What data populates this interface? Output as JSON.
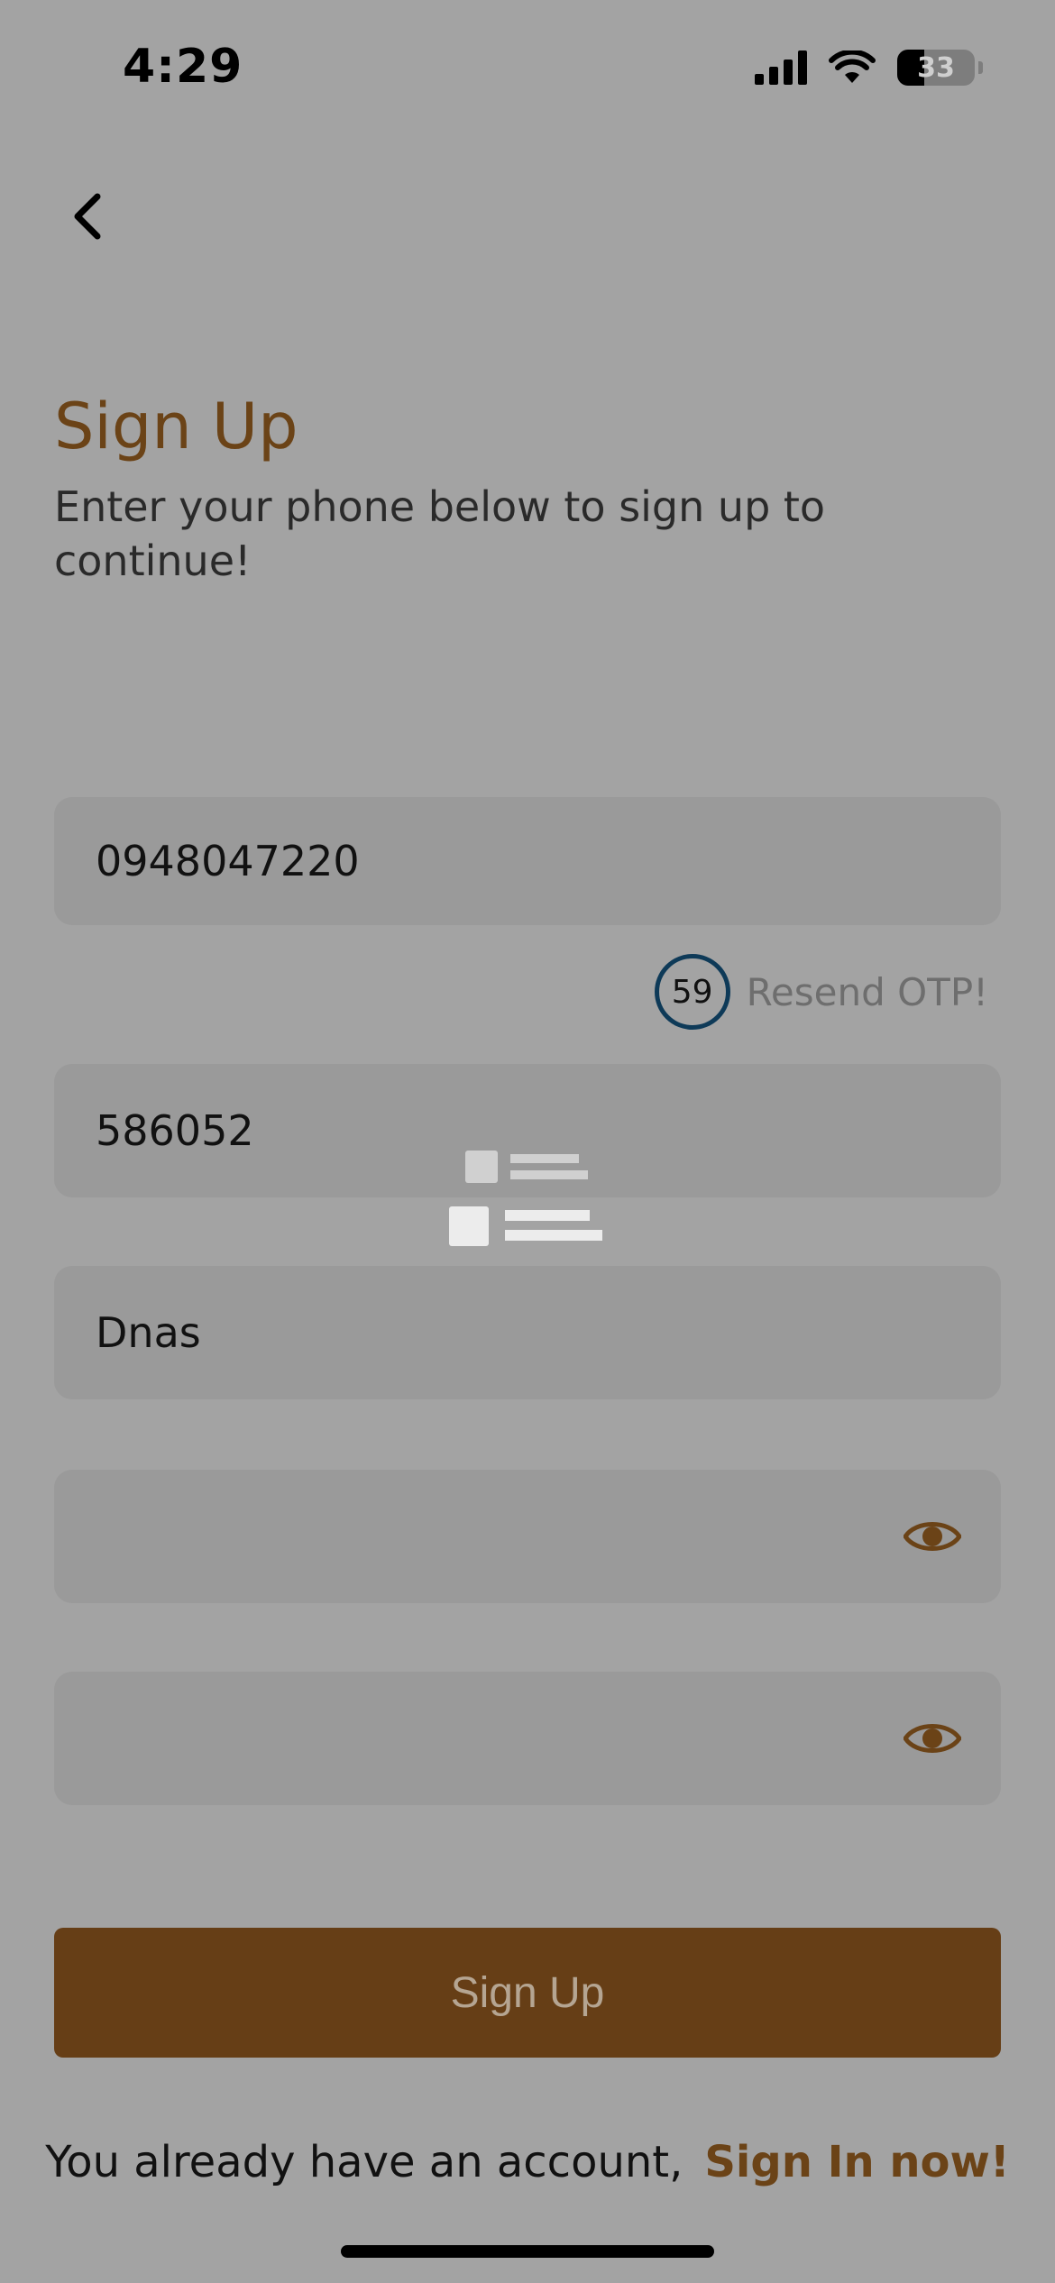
{
  "status_bar": {
    "time": "4:29",
    "battery": "33"
  },
  "header": {
    "title": "Sign Up",
    "subtitle": "Enter your phone below to sign up to continue!"
  },
  "form": {
    "phone_value": "0948047220",
    "otp_value": "586052",
    "name_value": "Dnas",
    "password_value": "",
    "confirm_password_value": "",
    "timer": "59",
    "resend_label": "Resend OTP!"
  },
  "actions": {
    "signup_label": "Sign Up",
    "account_text": "You already have an account,",
    "signin_link": "Sign In now!"
  },
  "colors": {
    "accent": "#6b4317",
    "button": "#663e16",
    "timer_ring": "#0e3a58"
  }
}
